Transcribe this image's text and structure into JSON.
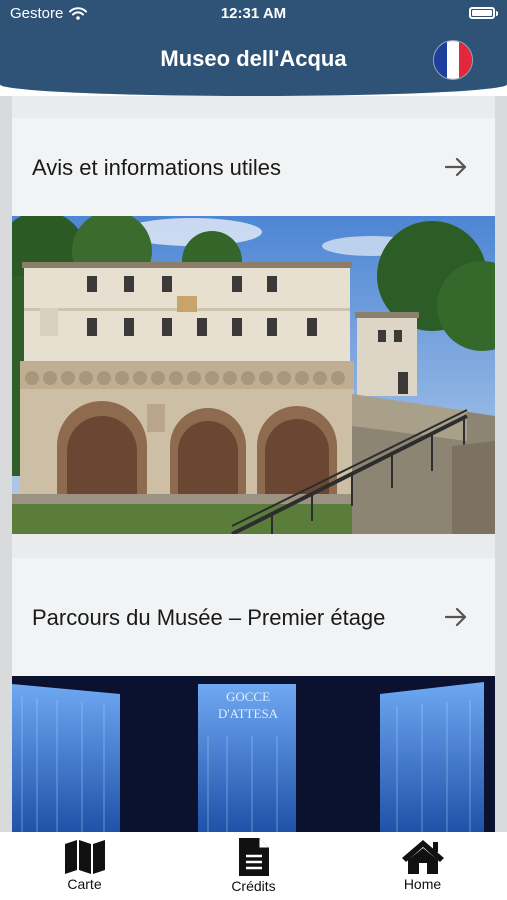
{
  "status_bar": {
    "carrier": "Gestore",
    "time": "12:31 AM"
  },
  "header": {
    "title": "Museo dell'Acqua",
    "language_flag": "france-flag-icon"
  },
  "cards": [
    {
      "title": "Avis et informations utiles",
      "icon": "arrow-right-icon"
    },
    {
      "title": "Parcours du Musée – Premier étage",
      "icon": "arrow-right-icon",
      "image_text": "GOCCE D'ATTESA"
    }
  ],
  "tabbar": {
    "items": [
      {
        "label": "Carte",
        "icon": "map-icon"
      },
      {
        "label": "Crédits",
        "icon": "document-icon"
      },
      {
        "label": "Home",
        "icon": "home-icon"
      }
    ]
  },
  "colors": {
    "header": "#2f5377",
    "card_header": "#f2f3f4",
    "background": "#d8dadc"
  }
}
